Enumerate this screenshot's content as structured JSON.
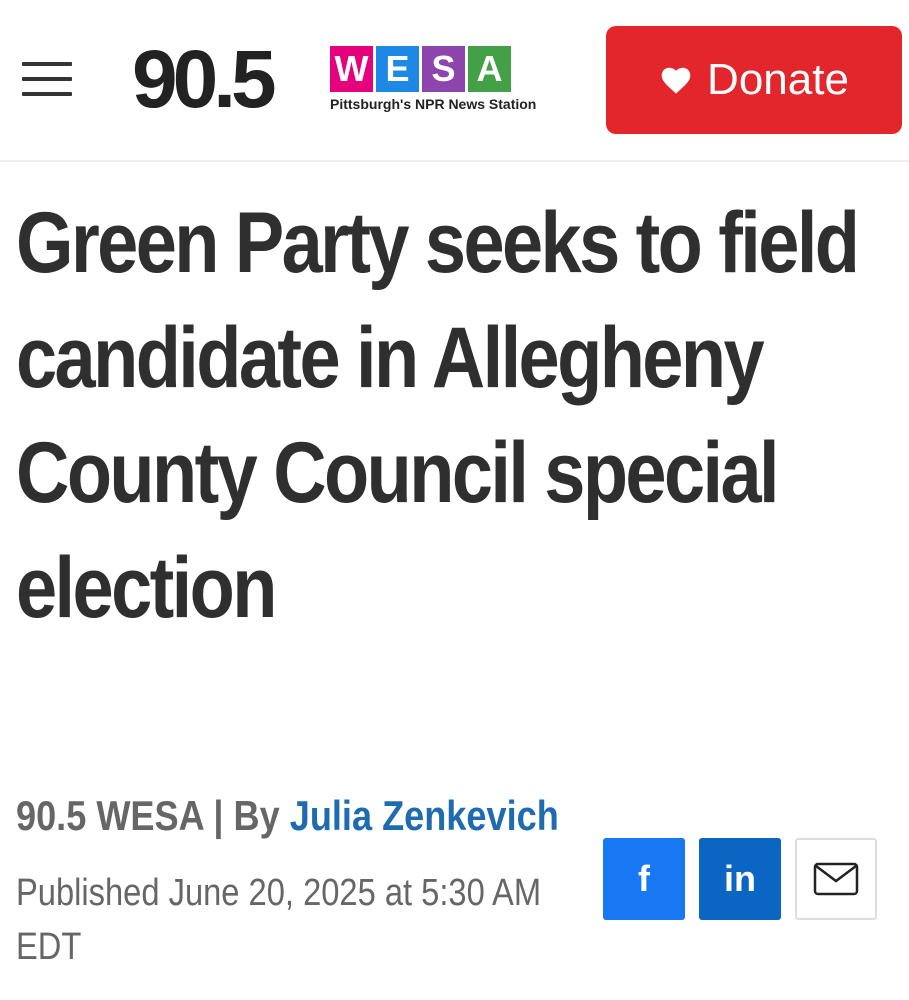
{
  "header": {
    "logo": {
      "number": "90.5",
      "letters": [
        {
          "char": "W",
          "color": "#e5007e"
        },
        {
          "char": "E",
          "color": "#1e88e5"
        },
        {
          "char": "S",
          "color": "#8e44ad"
        },
        {
          "char": "A",
          "color": "#43a047"
        }
      ],
      "tagline": "Pittsburgh's NPR News Station"
    },
    "donate_label": "Donate"
  },
  "article": {
    "headline": "Green Party seeks to field candidate in Allegheny County Council special election",
    "source": "90.5 WESA",
    "separator": " | ",
    "by": "By ",
    "author": "Julia Zenkevich",
    "published": "Published June 20, 2025 at 5:30 AM EDT"
  },
  "share": {
    "facebook_label": "f",
    "linkedin_label": "in"
  },
  "colors": {
    "donate": "#e2262b",
    "facebook": "#1877f2",
    "linkedin": "#0a66c2",
    "author_link": "#1f6bb0"
  }
}
